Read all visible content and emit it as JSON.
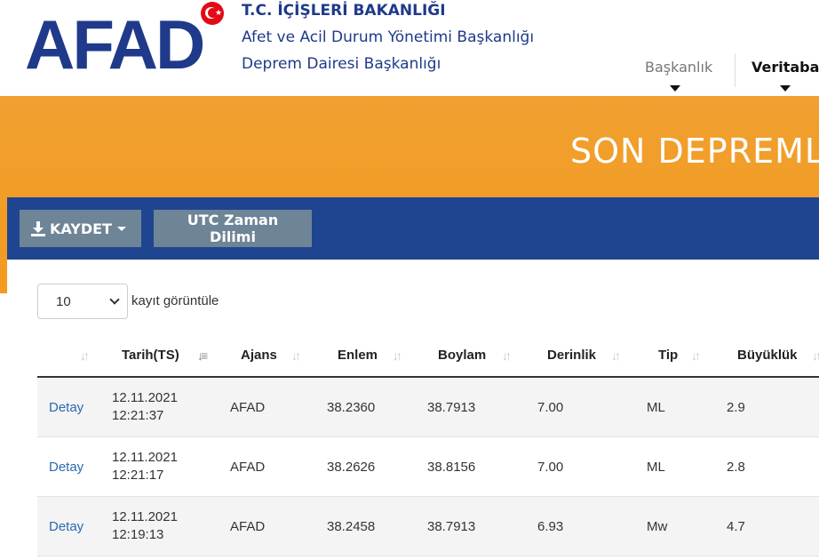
{
  "header": {
    "logo_text": "AFAD",
    "ministry": "T.C. İÇİŞLERİ BAKANLIĞI",
    "dept_line1": "Afet ve Acil Durum Yönetimi Başkanlığı",
    "dept_line2": "Deprem Dairesi Başkanlığı",
    "nav": [
      {
        "label": "Başkanlık"
      },
      {
        "label": "Veritaban"
      }
    ]
  },
  "banner": {
    "title": "SON DEPREMLE"
  },
  "toolbar": {
    "save_label": "KAYDET",
    "utc_label": "UTC Zaman Dilimi"
  },
  "length": {
    "value": "10",
    "label": "kayıt görüntüle"
  },
  "table": {
    "columns": [
      "",
      "Tarih(TS)",
      "Ajans",
      "Enlem",
      "Boylam",
      "Derinlik",
      "Tip",
      "Büyüklük"
    ],
    "rows": [
      {
        "action": "Detay",
        "date": "12.11.2021",
        "time": "12:21:37",
        "agency": "AFAD",
        "lat": "38.2360",
        "lon": "38.7913",
        "depth": "7.00",
        "type": "ML",
        "mag": "2.9"
      },
      {
        "action": "Detay",
        "date": "12.11.2021",
        "time": "12:21:17",
        "agency": "AFAD",
        "lat": "38.2626",
        "lon": "38.8156",
        "depth": "7.00",
        "type": "ML",
        "mag": "2.8"
      },
      {
        "action": "Detay",
        "date": "12.11.2021",
        "time": "12:19:13",
        "agency": "AFAD",
        "lat": "38.2458",
        "lon": "38.7913",
        "depth": "6.93",
        "type": "Mw",
        "mag": "4.7"
      }
    ]
  },
  "colors": {
    "brand_blue": "#1f3a8a",
    "toolbar_blue": "#1f4590",
    "banner_orange": "#f39a1f",
    "button_gray": "#6e8497",
    "link_blue": "#2a6ab0"
  }
}
